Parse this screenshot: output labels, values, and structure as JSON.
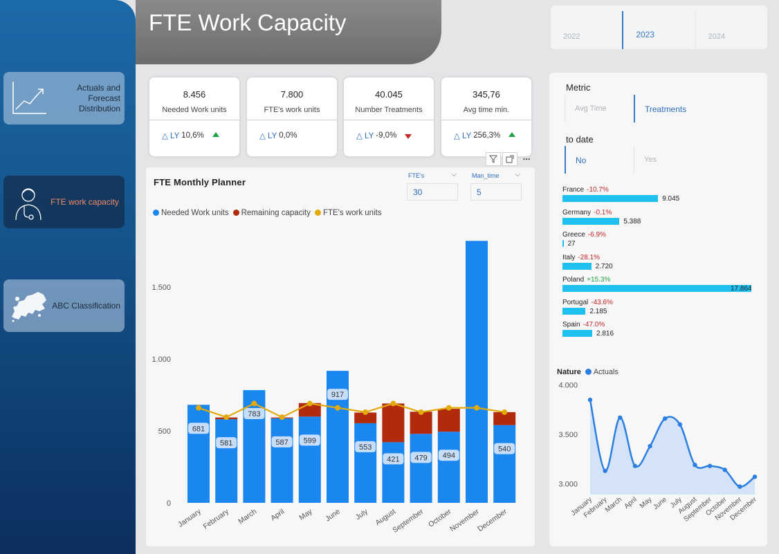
{
  "nav": {
    "items": [
      {
        "label": "Actuals and Forecast Distribution",
        "icon": "trend-chart-icon",
        "active": false
      },
      {
        "label": "FTE work capacity",
        "icon": "doctor-icon",
        "active": true
      },
      {
        "label": "ABC Classification",
        "icon": "europe-map-icon",
        "active": false
      }
    ]
  },
  "header": {
    "title": "FTE Work Capacity"
  },
  "years": {
    "options": [
      "2022",
      "2023",
      "2024"
    ],
    "selected": "2023"
  },
  "kpis": [
    {
      "value": "8.456",
      "label": "Needed Work units",
      "delta_prefix": "△ LY",
      "delta": "10,6%",
      "trend": "up"
    },
    {
      "value": "7.800",
      "label": "FTE's work units",
      "delta_prefix": "△ LY",
      "delta": "0,0%",
      "trend": "none"
    },
    {
      "value": "40.045",
      "label": "Number Treatments",
      "delta_prefix": "△ LY",
      "delta": "-9,0%",
      "trend": "down"
    },
    {
      "value": "345,76",
      "label": "Avg time min.",
      "delta_prefix": "△ LY",
      "delta": "256,3%",
      "trend": "up"
    }
  ],
  "planner": {
    "title": "FTE Monthly Planner",
    "params": [
      {
        "label": "FTE's",
        "value": "30"
      },
      {
        "label": "Man_time",
        "value": "5"
      }
    ],
    "legend": [
      {
        "label": "Needed Work units",
        "color": "#1a86f0"
      },
      {
        "label": "Remaining capacity",
        "color": "#b22a0c"
      },
      {
        "label": "FTE's work units",
        "color": "#e3aa0c"
      }
    ]
  },
  "metric": {
    "title": "Metric",
    "options": [
      "Avg Time",
      "Treatments"
    ],
    "selected": "Treatments"
  },
  "to_date": {
    "title": "to date",
    "options": [
      "No",
      "Yes"
    ],
    "selected": "No"
  },
  "countries": [
    {
      "name": "France",
      "pct": "-10.7%",
      "value": "9.045",
      "num": 9045,
      "sign": "neg"
    },
    {
      "name": "Germany",
      "pct": "-0.1%",
      "value": "5.388",
      "num": 5388,
      "sign": "neg"
    },
    {
      "name": "Greece",
      "pct": "-6.9%",
      "value": "27",
      "num": 27,
      "sign": "neg"
    },
    {
      "name": "Italy",
      "pct": "-28.1%",
      "value": "2.720",
      "num": 2720,
      "sign": "neg"
    },
    {
      "name": "Poland",
      "pct": "+15.3%",
      "value": "17.864",
      "num": 17864,
      "sign": "pos"
    },
    {
      "name": "Portugal",
      "pct": "-43.6%",
      "value": "2.185",
      "num": 2185,
      "sign": "neg"
    },
    {
      "name": "Spain",
      "pct": "-47.0%",
      "value": "2.816",
      "num": 2816,
      "sign": "neg"
    }
  ],
  "nature": {
    "title": "Nature",
    "series": "Actuals"
  },
  "chart_data": [
    {
      "type": "bar",
      "categories": [
        "January",
        "February",
        "March",
        "April",
        "May",
        "June",
        "July",
        "August",
        "September",
        "October",
        "November",
        "December"
      ],
      "series": [
        {
          "name": "Needed Work units",
          "values": [
            681,
            581,
            783,
            587,
            599,
            917,
            553,
            421,
            479,
            494,
            1820,
            540
          ]
        },
        {
          "name": "Remaining capacity",
          "values": [
            0,
            12,
            0,
            6,
            94,
            0,
            74,
            269,
            154,
            159,
            0,
            90
          ]
        },
        {
          "name": "FTE's work units",
          "values": [
            660,
            595,
            690,
            595,
            690,
            660,
            630,
            690,
            630,
            660,
            660,
            630
          ]
        }
      ],
      "data_labels": [
        "681",
        "581",
        "783",
        "587",
        "599",
        "917",
        "553",
        "421",
        "479",
        "494",
        "",
        "540"
      ],
      "yticks": [
        0,
        500,
        1000,
        1500
      ],
      "ytick_labels": [
        "0",
        "500",
        "1.000",
        "1.500"
      ],
      "ylim": [
        0,
        1850
      ]
    },
    {
      "type": "area",
      "categories": [
        "January",
        "February",
        "March",
        "April",
        "May",
        "June",
        "July",
        "August",
        "September",
        "October",
        "November",
        "December"
      ],
      "series": [
        {
          "name": "Actuals",
          "values": [
            3850,
            3130,
            3670,
            3180,
            3380,
            3660,
            3600,
            3190,
            3180,
            3140,
            2970,
            3070
          ]
        }
      ],
      "yticks": [
        3000,
        3500,
        4000
      ],
      "ytick_labels": [
        "3.000",
        "3.500",
        "4.000"
      ],
      "ylim": [
        2890,
        4040
      ]
    }
  ]
}
